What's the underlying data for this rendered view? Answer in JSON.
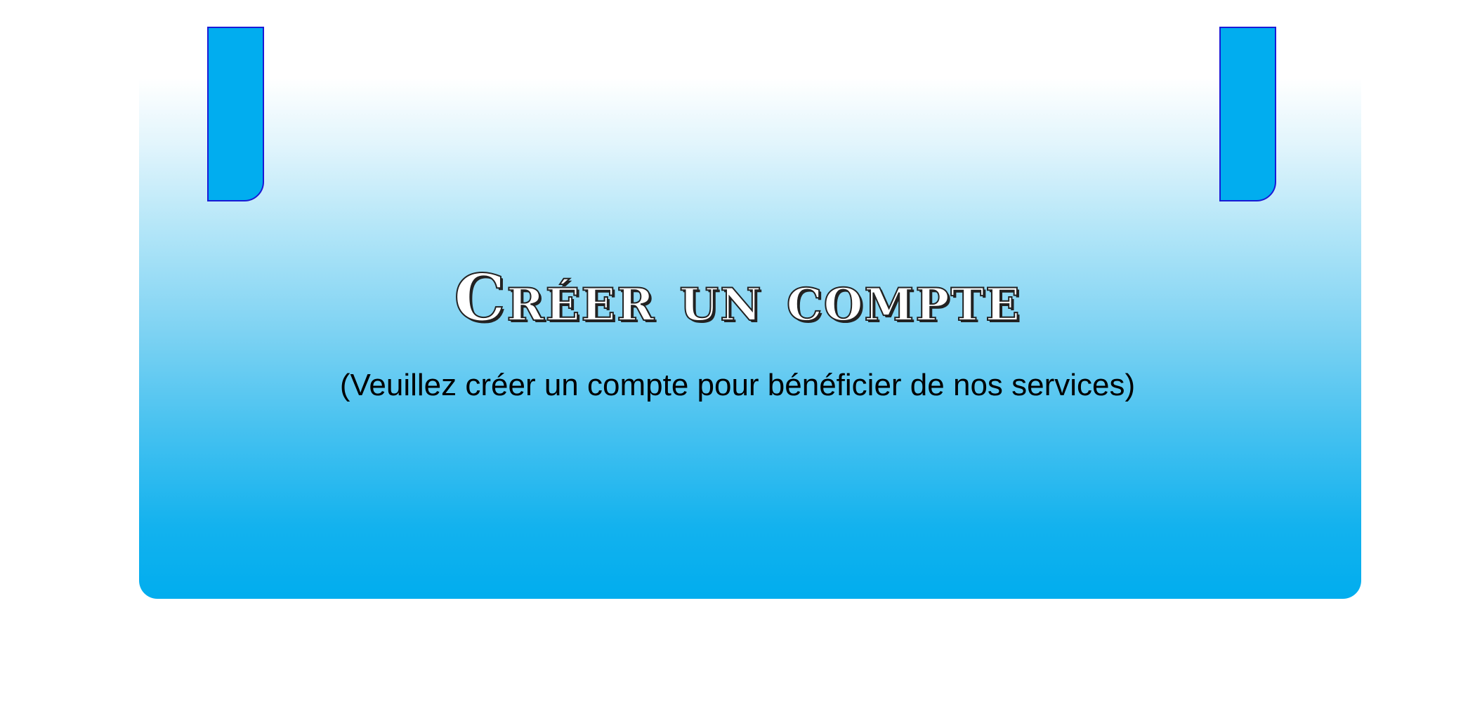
{
  "header": {
    "title": "Créer un compte",
    "subtitle": "(Veuillez créer un compte pour bénéficier de nos services)"
  },
  "colors": {
    "banner_top": "#ffffff",
    "banner_bottom": "#01adee",
    "tab_fill": "#01adef",
    "tab_border": "#1a1ad6",
    "title_text": "#222222",
    "subtitle_text": "#000000"
  }
}
